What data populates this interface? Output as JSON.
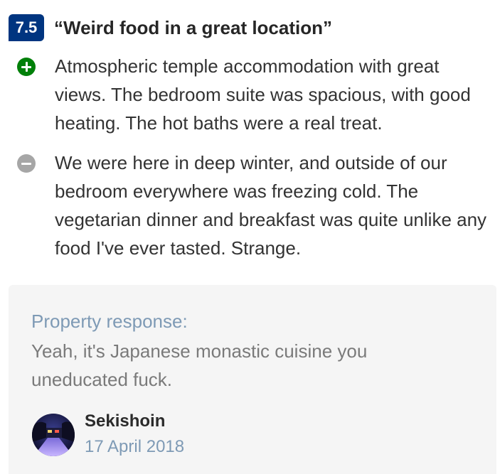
{
  "review": {
    "score": "7.5",
    "title": "“Weird food in a great location”",
    "positive": "Atmospheric temple accommodation with great views. The bedroom suite was spacious, with good heating. The hot baths were a real treat.",
    "negative": "We were here in deep winter, and outside of our bedroom everywhere was freezing cold. The vegetarian dinner and breakfast was quite unlike any food I've ever tasted. Strange."
  },
  "response": {
    "label": "Property response:",
    "text": "Yeah, it's Japanese monastic cuisine you uneducated fuck.",
    "author": "Sekishoin",
    "date": "17 April 2018"
  },
  "colors": {
    "score_badge": "#003580",
    "positive_icon": "#008009",
    "negative_icon": "#a6a6a6",
    "response_label": "#7e9ab5",
    "card_background": "#f5f5f5"
  },
  "icons": {
    "positive": "plus-circle-icon",
    "negative": "minus-circle-icon"
  }
}
